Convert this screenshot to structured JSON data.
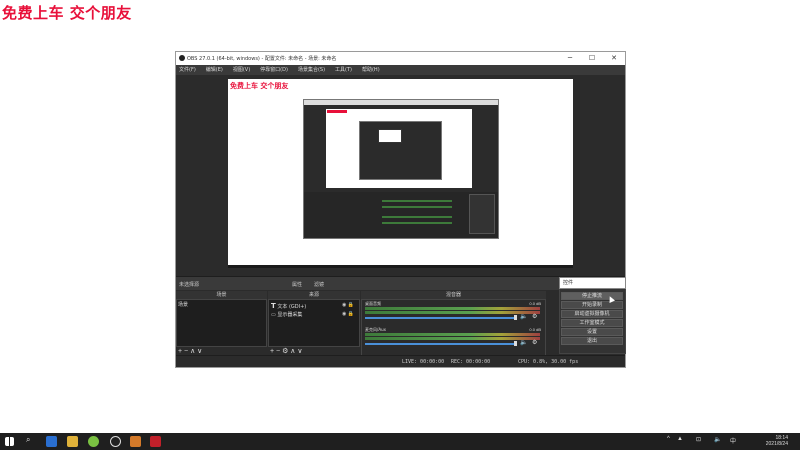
{
  "watermark": "免费上车 交个朋友",
  "obs": {
    "window_title": "OBS 27.0.1 (64-bit, windows) - 配置文件: 未命名 - 场景: 未命名",
    "controls_window": [
      "─",
      "☐",
      "✕"
    ],
    "menu": [
      "文件(F)",
      "编辑(E)",
      "视图(V)",
      "停靠窗口(D)",
      "场景集合(S)",
      "工具(T)",
      "帮助(H)"
    ],
    "preview_watermark": "免费上车 交个朋友",
    "dock_header": {
      "no_source": "未选择源",
      "tab_properties": "属性",
      "tab_filters": "滤镜"
    },
    "panels": {
      "scenes_title": "场景",
      "sources_title": "来源",
      "mixer_title": "混音器",
      "scene_items": [
        "场景"
      ],
      "source_items": [
        "文本 (GDI+)",
        "显示器采集"
      ],
      "mixer_rows": [
        {
          "label": "桌面音频",
          "db": "0.0 dB"
        },
        {
          "label": "麦克风/Aux",
          "db": "0.0 dB"
        }
      ],
      "footer_scenes": "+ − ∧ ∨",
      "footer_sources": "+ − ⚙ ∧ ∨"
    },
    "controls": {
      "input_value": "控件",
      "buttons": [
        "停止推流",
        "开始录制",
        "启动虚拟摄像机",
        "工作室模式",
        "设置",
        "退出"
      ],
      "highlighted_index": 0
    },
    "status": {
      "live": "LIVE: 00:00:00",
      "rec": "REC: 00:00:00",
      "cpu": "CPU: 0.8%, 30.00 fps"
    }
  },
  "taskbar": {
    "clock_time": "18:14",
    "clock_date": "2021/8/24",
    "tray_icons": [
      "^",
      "▲",
      "⊡",
      "🔈",
      "中"
    ]
  }
}
